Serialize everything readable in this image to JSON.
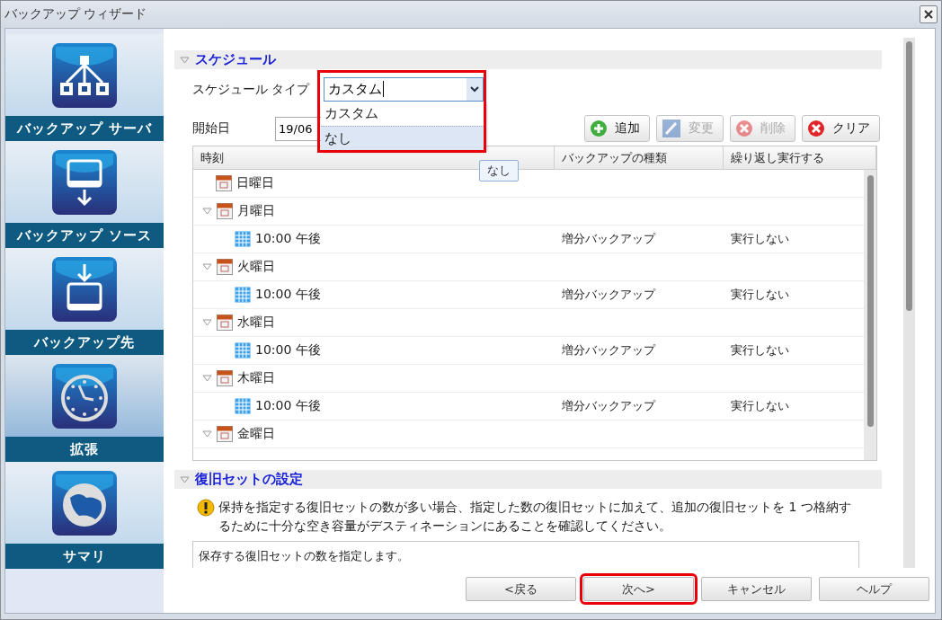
{
  "window": {
    "title": "バックアップ ウィザード"
  },
  "sidebar": {
    "items": [
      {
        "label": "バックアップ サーバ",
        "kind": "network",
        "selected": false
      },
      {
        "label": "バックアップ ソース",
        "kind": "drive-out",
        "selected": false
      },
      {
        "label": "バックアップ先",
        "kind": "drive-in",
        "selected": false
      },
      {
        "label": "拡張",
        "kind": "clock",
        "selected": true
      },
      {
        "label": "サマリ",
        "kind": "globe",
        "selected": false
      }
    ]
  },
  "schedule": {
    "title": "スケジュール",
    "expanded": true,
    "schedule_type": {
      "label": "スケジュール タイプ",
      "value": "カスタム",
      "open": true,
      "highlighted": true,
      "options": [
        {
          "label": "カスタム",
          "hovered": false
        },
        {
          "label": "なし",
          "hovered": true
        }
      ]
    },
    "tooltip": "なし",
    "start_date": {
      "label": "開始日",
      "value": "19/06"
    },
    "toolbar": [
      {
        "label": "追加",
        "kind": "add",
        "disabled": false
      },
      {
        "label": "変更",
        "kind": "edit",
        "disabled": true
      },
      {
        "label": "削除",
        "kind": "delete",
        "disabled": true
      },
      {
        "label": "クリア",
        "kind": "clear",
        "disabled": false
      }
    ],
    "table": {
      "columns": [
        "時刻",
        "バックアップの種類",
        "繰り返し実行する"
      ],
      "rows": [
        {
          "label": "日曜日"
        },
        {
          "label": "月曜日",
          "expanded": true,
          "children": [
            {
              "label": "10:00 午後",
              "type": "増分バックアップ",
              "repeat": "実行しない"
            }
          ]
        },
        {
          "label": "火曜日",
          "expanded": true,
          "children": [
            {
              "label": "10:00 午後",
              "type": "増分バックアップ",
              "repeat": "実行しない"
            }
          ]
        },
        {
          "label": "水曜日",
          "expanded": true,
          "children": [
            {
              "label": "10:00 午後",
              "type": "増分バックアップ",
              "repeat": "実行しない"
            }
          ]
        },
        {
          "label": "木曜日",
          "expanded": true,
          "children": [
            {
              "label": "10:00 午後",
              "type": "増分バックアップ",
              "repeat": "実行しない"
            }
          ]
        },
        {
          "label": "金曜日",
          "expanded": true
        }
      ]
    }
  },
  "recovery": {
    "title": "復旧セットの設定",
    "expanded": true,
    "warning": "保持を指定する復旧セットの数が多い場合、指定した数の復旧セットに加えて、追加の復旧セットを 1 つ格納するために十分な空き容量がデスティネーションにあることを確認してください。",
    "description": "保存する復旧セットの数を指定します。"
  },
  "buttons": [
    {
      "label": "<戻る",
      "highlighted": false
    },
    {
      "label": "次へ>",
      "highlighted": true
    },
    {
      "label": "キャンセル",
      "highlighted": false
    },
    {
      "label": "ヘルプ",
      "highlighted": false
    }
  ]
}
